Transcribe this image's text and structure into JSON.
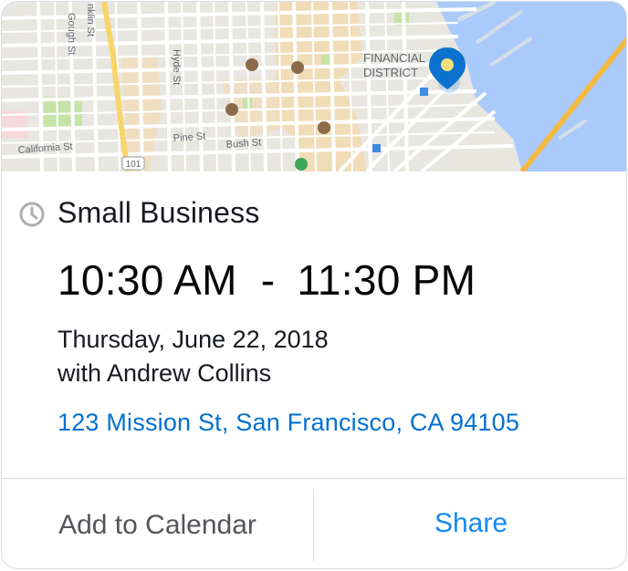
{
  "map": {
    "labels": {
      "financial_district_1": "FINANCIAL",
      "financial_district_2": "DISTRICT",
      "california_st": "California St",
      "pine_st": "Pine St",
      "bush_st": "Bush St",
      "hyde_st": "Hyde St",
      "gough_st": "Gough St",
      "franklin_st": "nklin St",
      "highway": "101"
    },
    "pin_color": "#0b72cf",
    "water_color": "#a9cafa"
  },
  "event": {
    "title": "Small Business",
    "start_time": "10:30 AM",
    "separator": "-",
    "end_time": "11:30 PM",
    "date": "Thursday, June 22, 2018",
    "with": "with Andrew Collins",
    "address": "123 Mission St, San Francisco, CA 94105"
  },
  "actions": {
    "add_to_calendar": "Add to Calendar",
    "share": "Share"
  },
  "colors": {
    "link": "#0070d2",
    "share": "#1589ee",
    "title": "#16191f"
  }
}
